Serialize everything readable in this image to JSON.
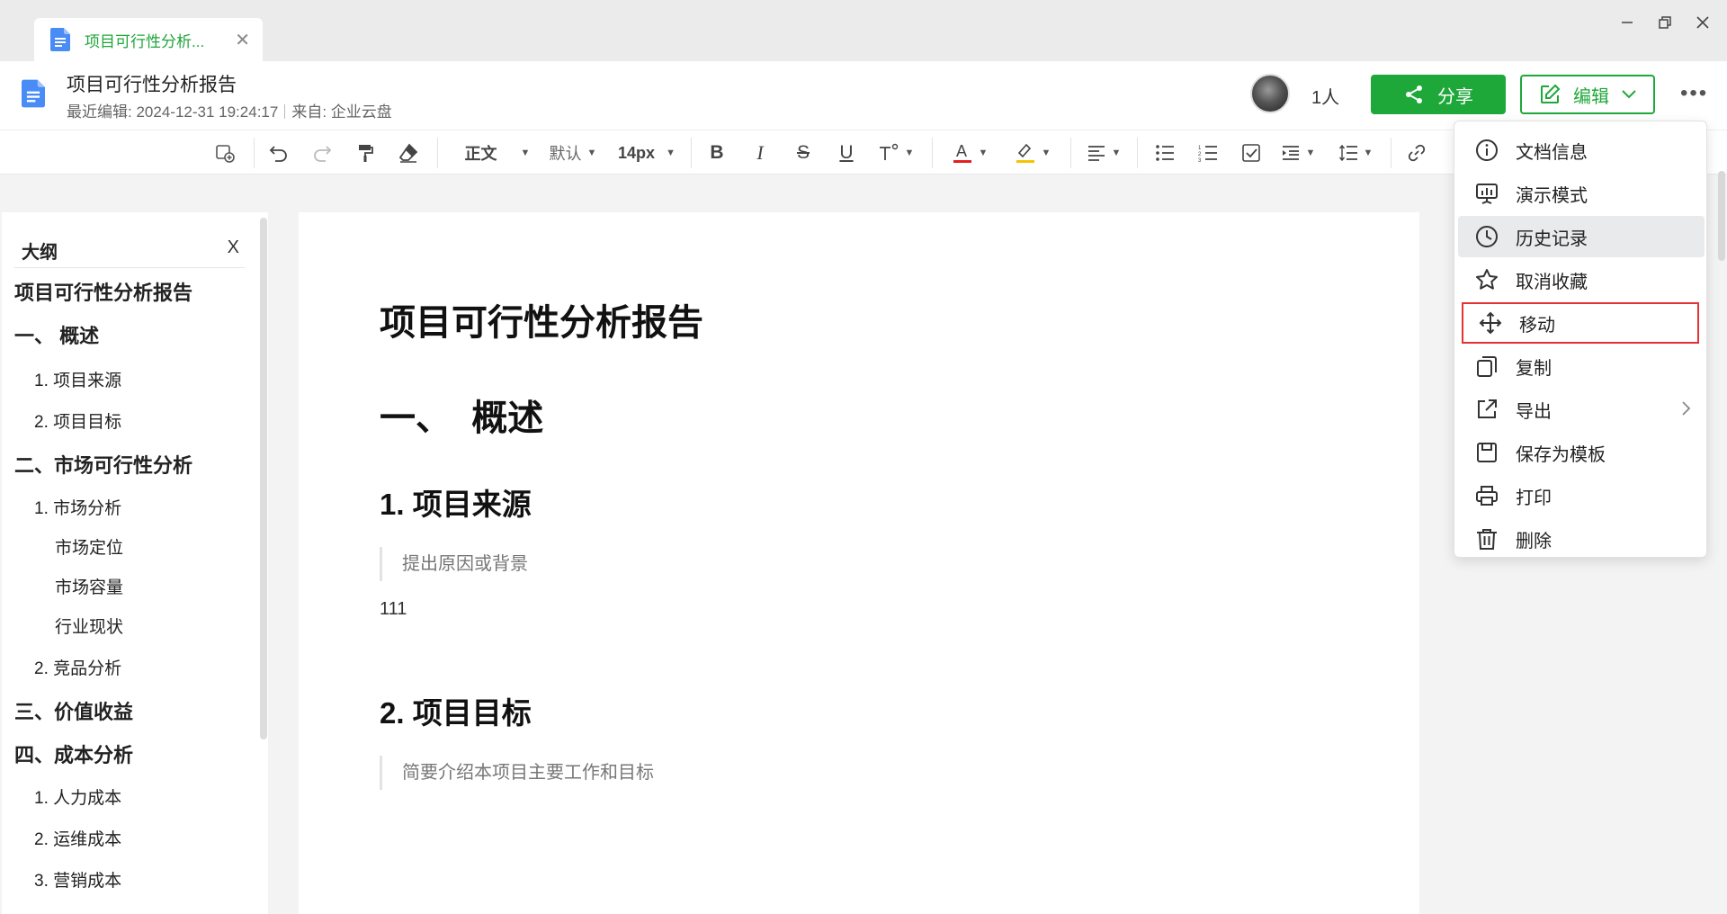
{
  "tab": {
    "title": "项目可行性分析..."
  },
  "header": {
    "title": "项目可行性分析报告",
    "last_edited_label": "最近编辑:",
    "last_edited_time": "2024-12-31 19:24:17",
    "source_label": "来自:",
    "source_value": "企业云盘",
    "people_count": "1人",
    "share_label": "分享",
    "edit_label": "编辑"
  },
  "toolbar": {
    "style": "正文",
    "font": "默认",
    "size": "14px"
  },
  "sidebar": {
    "title": "大纲",
    "close": "X",
    "items": [
      {
        "label": "项目可行性分析报告",
        "level": 1
      },
      {
        "label": "一、 概述",
        "level": 1
      },
      {
        "label": "1. 项目来源",
        "level": 2
      },
      {
        "label": "2. 项目目标",
        "level": 2
      },
      {
        "label": "二、市场可行性分析",
        "level": 1
      },
      {
        "label": "1. 市场分析",
        "level": 2
      },
      {
        "label": "市场定位",
        "level": 3
      },
      {
        "label": "市场容量",
        "level": 3
      },
      {
        "label": "行业现状",
        "level": 3
      },
      {
        "label": "2. 竞品分析",
        "level": 2
      },
      {
        "label": "三、价值收益",
        "level": 1
      },
      {
        "label": "四、成本分析",
        "level": 1
      },
      {
        "label": "1. 人力成本",
        "level": 2
      },
      {
        "label": "2. 运维成本",
        "level": 2
      },
      {
        "label": "3. 营销成本",
        "level": 2
      }
    ]
  },
  "document": {
    "title": "项目可行性分析报告",
    "h1_1": "一、  概述",
    "h2_1": "1. 项目来源",
    "quote_1": "提出原因或背景",
    "para_1": "111",
    "h2_2": "2. 项目目标",
    "quote_2": "简要介绍本项目主要工作和目标"
  },
  "menu": {
    "items": [
      {
        "label": "文档信息",
        "icon": "info-icon"
      },
      {
        "label": "演示模式",
        "icon": "presentation-icon"
      },
      {
        "label": "历史记录",
        "icon": "clock-icon"
      },
      {
        "label": "取消收藏",
        "icon": "star-icon"
      },
      {
        "label": "移动",
        "icon": "move-icon"
      },
      {
        "label": "复制",
        "icon": "copy-icon"
      },
      {
        "label": "导出",
        "icon": "export-icon"
      },
      {
        "label": "保存为模板",
        "icon": "template-icon"
      },
      {
        "label": "打印",
        "icon": "print-icon"
      },
      {
        "label": "删除",
        "icon": "trash-icon"
      }
    ]
  },
  "colors": {
    "brand": "#1fa83a",
    "highlight_outline": "#e63232",
    "hover": "#e9eaeb"
  }
}
